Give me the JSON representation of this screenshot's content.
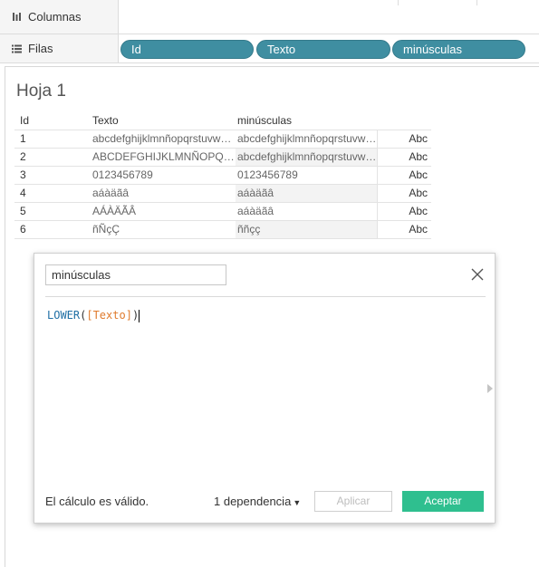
{
  "shelves": {
    "columns_label": "Columnas",
    "rows_label": "Filas",
    "row_pills": [
      "Id",
      "Texto",
      "minúsculas"
    ]
  },
  "sheet": {
    "title": "Hoja 1",
    "headers": [
      "Id",
      "Texto",
      "minúsculas"
    ],
    "rows": [
      {
        "id": "1",
        "texto": "abcdefghijklmnñopqrstuvwxyz",
        "minusculas": "abcdefghijklmnñopqrstuvwxyz",
        "abc": "Abc"
      },
      {
        "id": "2",
        "texto": "ABCDEFGHIJKLMNÑOPQRSTUVWXYZ",
        "minusculas": "abcdefghijklmnñopqrstuvwxyz",
        "abc": "Abc"
      },
      {
        "id": "3",
        "texto": "0123456789",
        "minusculas": "0123456789",
        "abc": "Abc"
      },
      {
        "id": "4",
        "texto": "aáàäãâ",
        "minusculas": "aáàäãâ",
        "abc": "Abc"
      },
      {
        "id": "5",
        "texto": "AÁÀÄÃÂ",
        "minusculas": "aáàäãâ",
        "abc": "Abc"
      },
      {
        "id": "6",
        "texto": "ñÑçÇ",
        "minusculas": "ññçç",
        "abc": "Abc"
      }
    ]
  },
  "dialog": {
    "name_value": "minúsculas",
    "formula": {
      "func": "LOWER",
      "open": "(",
      "field": "[Texto]",
      "close": ")"
    },
    "status": "El cálculo es válido.",
    "dependencies": "1 dependencia",
    "apply_label": "Aplicar",
    "accept_label": "Aceptar"
  },
  "colors": {
    "pill": "#3f8ea1",
    "accept_button": "#2fbf8f",
    "function_text": "#1f6fa5",
    "field_text": "#e07b2e"
  },
  "icons": {
    "columns": "columns-icon",
    "rows": "rows-icon",
    "close": "close-icon",
    "side": "triangle-right-icon",
    "dropdown": "caret-down-icon"
  }
}
